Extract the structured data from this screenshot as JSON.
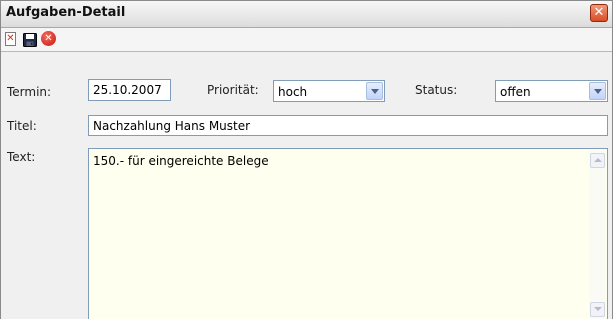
{
  "window": {
    "title": "Aufgaben-Detail",
    "close_glyph": "✕"
  },
  "toolbar": {
    "icons": [
      "close-document-icon",
      "save-icon",
      "delete-icon"
    ],
    "cancel_glyph": "✕",
    "delete_glyph": "✕"
  },
  "form": {
    "termin_label": "Termin:",
    "termin_value": "25.10.2007",
    "prioritaet_label": "Priorität:",
    "prioritaet_value": "hoch",
    "status_label": "Status:",
    "status_value": "offen",
    "titel_label": "Titel:",
    "titel_value": "Nachzahlung Hans Muster",
    "text_label": "Text:",
    "text_value": "150.- für eingereichte Belege"
  },
  "colors": {
    "close_button": "#d94d24",
    "textarea_background": "#fffff0",
    "delete_icon": "#c8170c",
    "field_border": "#7f9db9"
  }
}
